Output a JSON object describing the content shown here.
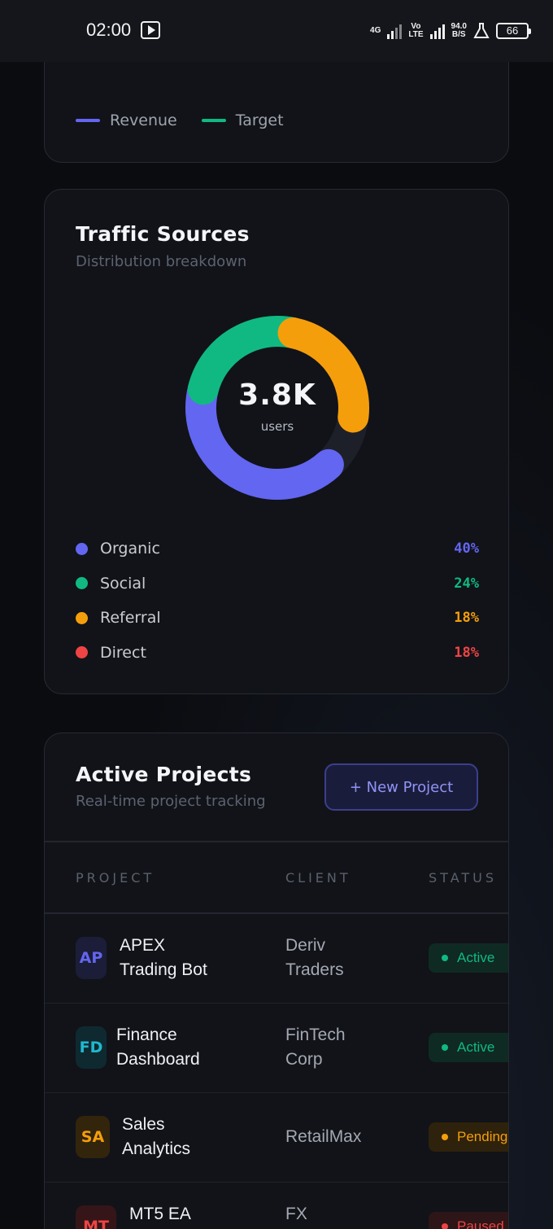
{
  "status_bar": {
    "time": "02:00",
    "network_1": "4G",
    "network_2_top": "Vo",
    "network_2_bottom": "LTE",
    "speed_top": "94.0",
    "speed_bottom": "B/S",
    "battery": "66"
  },
  "revenue_card": {
    "legend": [
      {
        "label": "Revenue",
        "color": "#6366f1"
      },
      {
        "label": "Target",
        "color": "#10b981"
      }
    ]
  },
  "traffic_card": {
    "title": "Traffic Sources",
    "subtitle": "Distribution breakdown",
    "center_value": "3.8K",
    "center_label": "users",
    "sources": [
      {
        "name": "Organic",
        "percent": "40%",
        "color": "#6366f1"
      },
      {
        "name": "Social",
        "percent": "24%",
        "color": "#10b981"
      },
      {
        "name": "Referral",
        "percent": "18%",
        "color": "#f59e0b"
      },
      {
        "name": "Direct",
        "percent": "18%",
        "color": "#ef4444"
      }
    ]
  },
  "projects_card": {
    "title": "Active Projects",
    "subtitle": "Real-time project tracking",
    "new_button": "+ New Project",
    "columns": [
      "PROJECT",
      "CLIENT",
      "STATUS"
    ],
    "rows": [
      {
        "initials": "AP",
        "name": "APEX\nTrading Bot",
        "client": "Deriv\nTraders",
        "status": "Active",
        "avatar_color": "#6366f1",
        "avatar_bg": "#1c1d38",
        "status_color": "#10b981",
        "status_bg": "#0f2a22"
      },
      {
        "initials": "FD",
        "name": "Finance\nDashboard",
        "client": "FinTech\nCorp",
        "status": "Active",
        "avatar_color": "#22b8cf",
        "avatar_bg": "#0e2a30",
        "status_color": "#10b981",
        "status_bg": "#0f2a22"
      },
      {
        "initials": "SA",
        "name": "Sales\nAnalytics",
        "client": "RetailMax",
        "status": "Pending",
        "avatar_color": "#f59e0b",
        "avatar_bg": "#33240c",
        "status_color": "#f59e0b",
        "status_bg": "#2e220c"
      },
      {
        "initials": "MT",
        "name": "MT5 EA",
        "client": "FX",
        "status": "Paused",
        "avatar_color": "#ef4444",
        "avatar_bg": "#351518",
        "status_color": "#ef4444",
        "status_bg": "#2e1517"
      }
    ]
  }
}
